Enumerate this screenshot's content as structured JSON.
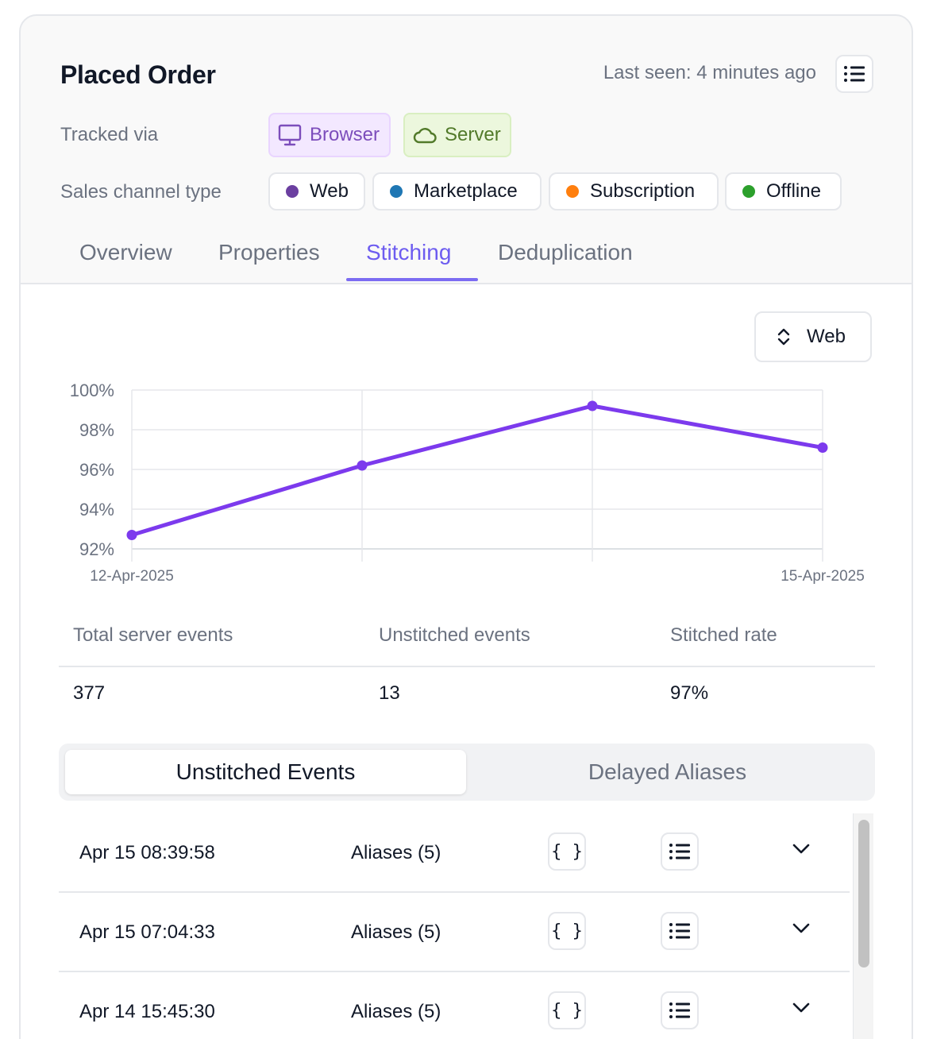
{
  "header": {
    "title": "Placed Order",
    "last_seen": "Last seen: 4 minutes ago",
    "menu_icon": "list-icon"
  },
  "tracked_via": {
    "label": "Tracked via",
    "items": [
      {
        "label": "Browser",
        "icon": "monitor-icon",
        "color": "#7c4dbb"
      },
      {
        "label": "Server",
        "icon": "cloud-icon",
        "color": "#527a2a"
      }
    ]
  },
  "sales_channel": {
    "label": "Sales channel type",
    "items": [
      {
        "label": "Web",
        "color": "#6b3fa0"
      },
      {
        "label": "Marketplace",
        "color": "#1f77b4"
      },
      {
        "label": "Subscription",
        "color": "#ff7f0e"
      },
      {
        "label": "Offline",
        "color": "#2ca02c"
      }
    ]
  },
  "tabs": [
    "Overview",
    "Properties",
    "Stitching",
    "Deduplication"
  ],
  "active_tab": "Stitching",
  "channel_select": {
    "value": "Web",
    "icon": "chevron-up-down-icon"
  },
  "chart_data": {
    "type": "line",
    "x": [
      "12-Apr-2025",
      "13-Apr-2025",
      "14-Apr-2025",
      "15-Apr-2025"
    ],
    "x_tick_labels": [
      "12-Apr-2025",
      "15-Apr-2025"
    ],
    "series": [
      {
        "values": [
          92.7,
          96.2,
          99.2,
          97.1
        ],
        "color": "#7c3aed"
      }
    ],
    "ylim": [
      92,
      100
    ],
    "y_ticks": [
      "92%",
      "94%",
      "96%",
      "98%",
      "100%"
    ],
    "grid": true
  },
  "stats": {
    "headers": [
      "Total server events",
      "Unstitched events",
      "Stitched rate"
    ],
    "values": [
      "377",
      "13",
      "97%"
    ]
  },
  "segmented": {
    "active": "Unstitched Events",
    "inactive": "Delayed Aliases"
  },
  "events": [
    {
      "time": "Apr 15 08:39:58",
      "aliases": "Aliases (5)",
      "json_label": "{ }"
    },
    {
      "time": "Apr 15 07:04:33",
      "aliases": "Aliases (5)",
      "json_label": "{ }"
    },
    {
      "time": "Apr 14 15:45:30",
      "aliases": "Aliases (5)",
      "json_label": "{ }"
    }
  ]
}
